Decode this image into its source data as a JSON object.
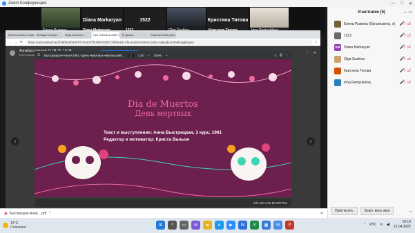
{
  "zoom": {
    "window_title": "Zoom Конференция",
    "window_buttons": [
      "—",
      "□",
      "✕"
    ]
  },
  "thumbnails": [
    {
      "name": "Елена Рыжина"
    },
    {
      "name": "Diana Markaryan",
      "display": "Diana Markaryan"
    },
    {
      "name": "1522",
      "display": "1522"
    },
    {
      "name": "Olga Sazhina"
    },
    {
      "name": "Кристина Титова",
      "display": "Кристина Титова"
    },
    {
      "name": "Irina Rentyukhina"
    }
  ],
  "participants_panel": {
    "title": "Участники (6)",
    "participants": [
      {
        "initials": "",
        "name": "Елена Рыжина (Организатор, я)",
        "avatar_color": "#7a5c3a"
      },
      {
        "initials": "",
        "name": "1522",
        "avatar_color": "#6a6a6a"
      },
      {
        "initials": "DM",
        "name": "Diana Markaryan",
        "avatar_color": "#8e44ad"
      },
      {
        "initials": "",
        "name": "Olga Sazhina",
        "avatar_color": "#c9a26b"
      },
      {
        "initials": "",
        "name": "Кристина Титова",
        "avatar_color": "#d35400"
      },
      {
        "initials": "",
        "name": "Irina Rentyukhina",
        "avatar_color": "#2980b9"
      }
    ],
    "invite_label": "Пригласить",
    "mute_all_label": "Выкл. весь звук",
    "more_label": "..."
  },
  "browser": {
    "tabs": [
      "Мастер-класс в школе...",
      "Вкладка Google...",
      "Вход Конспект...",
      "Про Чтение в Анне 1...",
      "Тв Диска...",
      "Участник в Виртуал..."
    ],
    "url": "drive.mail.ru/attaches/33505480430707944297fc38076383179b0e1d+3fa-email+kristimurzabo-sqkwdj=fe40eb4gg9ogwv"
  },
  "viewer": {
    "file_name": "АннаБыстрицкая",
    "file_meta": "21.04.22, 10:34",
    "file_sub": "Быстрицкая Анна 1... • Быстрицкая Анна 1961 .pdf • 15,1 МБ",
    "share_label": "Поделиться ссылкой",
    "save_cloud_label": "Сохранить в Облако",
    "download_label": "Скачать файл"
  },
  "pdf": {
    "doc_name": "Быстрицкая+Анна+1961.+День+мертвых+милашский...",
    "page": "1",
    "total": "/ 18",
    "zoom": "100%"
  },
  "slide": {
    "title_es": "Día de Muertos",
    "title_ru": "День мертвых",
    "line1": "Текст и выступление: Анна Быстрицкая, 3 курс, 1961",
    "line2": "Редактор и мотиватор: Криста Вальон"
  },
  "page_footer": {
    "text": "DÍA DE LOS MUERTOS"
  },
  "download_bar": {
    "file": "Быстрицкая Анна ...pdf"
  },
  "taskbar": {
    "temperature": "12°C",
    "weather": "Солнечно",
    "language": "РУС",
    "time": "16:10",
    "date": "21.04.2022"
  }
}
